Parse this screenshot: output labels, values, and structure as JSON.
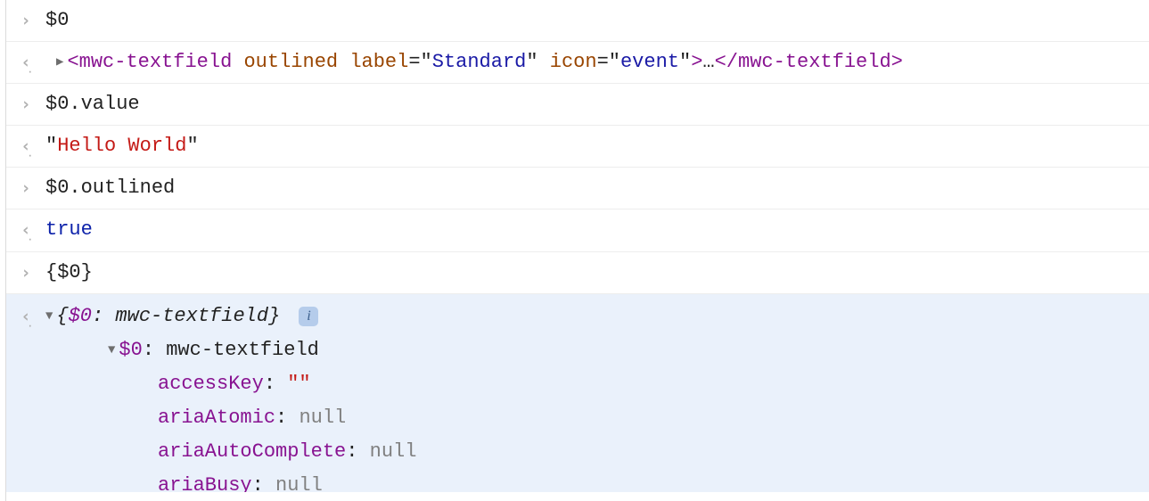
{
  "rows": [
    {
      "kind": "input",
      "text": "$0"
    },
    {
      "kind": "output-element",
      "element": {
        "tag_open": "mwc-textfield",
        "attrs": [
          {
            "name": "outlined",
            "value": null
          },
          {
            "name": "label",
            "value": "Standard"
          },
          {
            "name": "icon",
            "value": "event"
          }
        ],
        "ellipsis": "…",
        "tag_close": "mwc-textfield"
      }
    },
    {
      "kind": "input",
      "text": "$0.value"
    },
    {
      "kind": "output-string",
      "text": "Hello World"
    },
    {
      "kind": "input",
      "text": "$0.outlined"
    },
    {
      "kind": "output-bool",
      "text": "true"
    },
    {
      "kind": "input",
      "text": "{$0}"
    }
  ],
  "expanded": {
    "summary_key": "$0",
    "summary_type": "mwc-textfield",
    "entry_key": "$0",
    "entry_type": "mwc-textfield",
    "props": [
      {
        "key": "accessKey",
        "value": "\"\"",
        "valueKind": "string"
      },
      {
        "key": "ariaAtomic",
        "value": "null",
        "valueKind": "null"
      },
      {
        "key": "ariaAutoComplete",
        "value": "null",
        "valueKind": "null"
      },
      {
        "key": "ariaBusy",
        "value": "null",
        "valueKind": "null"
      }
    ],
    "info_label": "i"
  }
}
